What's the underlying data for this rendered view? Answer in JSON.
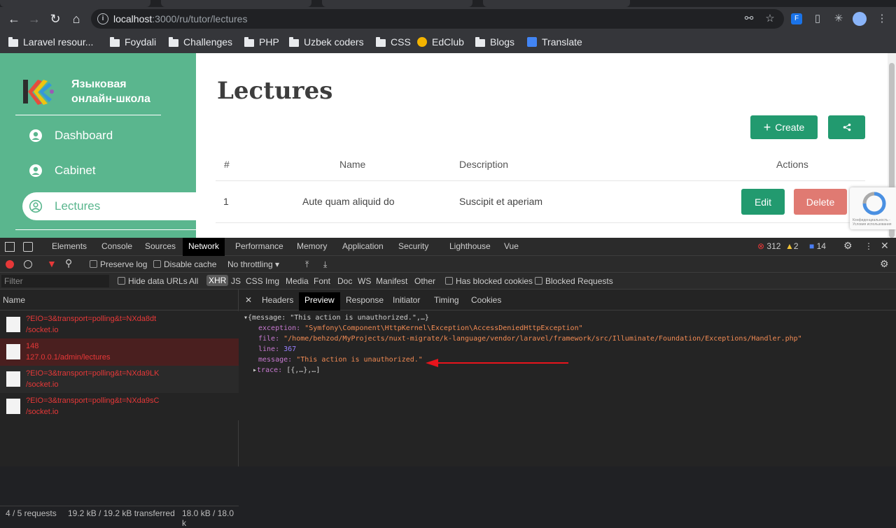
{
  "browser": {
    "url_host": "localhost",
    "url_path": ":3000/ru/tutor/lectures",
    "bookmarks": [
      "Laravel resour...",
      "Foydali",
      "Challenges",
      "PHP",
      "Uzbek coders",
      "CSS",
      "EdClub",
      "Blogs",
      "Translate"
    ]
  },
  "app": {
    "brand": [
      "Языковая",
      "онлайн-школа"
    ],
    "nav": [
      {
        "label": "Dashboard"
      },
      {
        "label": "Cabinet"
      },
      {
        "label": "Lectures",
        "active": true
      }
    ],
    "page_title": "Lectures",
    "create_label": "Create",
    "table": {
      "headers": [
        "#",
        "Name",
        "Description",
        "Actions"
      ],
      "rows": [
        {
          "id": "1",
          "name": "Aute quam aliquid do",
          "description": "Suscipit et aperiam",
          "edit": "Edit",
          "delete": "Delete"
        }
      ]
    },
    "recaptcha_text": "Конфиденциальность - Условия использования"
  },
  "devtools": {
    "tabs": [
      "Elements",
      "Console",
      "Sources",
      "Network",
      "Performance",
      "Memory",
      "Application",
      "Security",
      "Lighthouse",
      "Vue"
    ],
    "active_tab": "Network",
    "errors": "312",
    "warnings": "2",
    "messages": "14",
    "toolbar": {
      "preserve_log": "Preserve log",
      "disable_cache": "Disable cache",
      "throttling": "No throttling"
    },
    "filter": {
      "placeholder": "Filter",
      "hide_data_urls": "Hide data URLs",
      "types": [
        "All",
        "XHR",
        "JS",
        "CSS",
        "Img",
        "Media",
        "Font",
        "Doc",
        "WS",
        "Manifest",
        "Other"
      ],
      "has_blocked_cookies": "Has blocked cookies",
      "blocked_requests": "Blocked Requests"
    },
    "requests_header": "Name",
    "requests": [
      {
        "line1": "?EIO=3&transport=polling&t=NXda8dt",
        "line2": "/socket.io"
      },
      {
        "line1": "148",
        "line2": "127.0.0.1/admin/lectures"
      },
      {
        "line1": "?EIO=3&transport=polling&t=NXda9LK",
        "line2": "/socket.io"
      },
      {
        "line1": "?EIO=3&transport=polling&t=NXda9sC",
        "line2": "/socket.io"
      }
    ],
    "status": {
      "requests": "4 / 5 requests",
      "transferred": "19.2 kB / 19.2 kB transferred",
      "resources": "18.0 kB / 18.0 k"
    },
    "preview_tabs": [
      "Headers",
      "Preview",
      "Response",
      "Initiator",
      "Timing",
      "Cookies"
    ],
    "active_preview_tab": "Preview",
    "json": {
      "summary": "{message: \"This action is unauthorized.\",…}",
      "exception_key": "exception:",
      "exception_val": "\"Symfony\\Component\\HttpKernel\\Exception\\AccessDeniedHttpException\"",
      "file_key": "file:",
      "file_val": "\"/home/behzod/MyProjects/nuxt-migrate/k-language/vendor/laravel/framework/src/Illuminate/Foundation/Exceptions/Handler.php\"",
      "line_key": "line:",
      "line_val": "367",
      "message_key": "message:",
      "message_val": "\"This action is unauthorized.\"",
      "trace_key": "trace:",
      "trace_val": "[{,…},…]"
    }
  },
  "colors": {
    "sidebar": "#5ab68e",
    "primary_button": "#229a6f",
    "delete_button": "#e07a72",
    "annotation_arrow": "#e8141c"
  }
}
